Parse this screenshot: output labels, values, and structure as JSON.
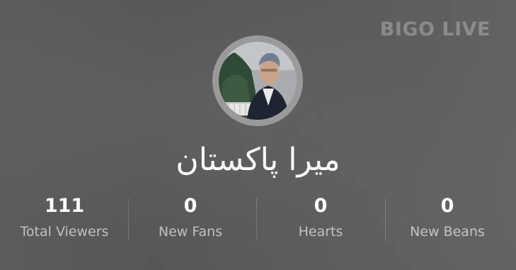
{
  "watermark": "BIGO LIVE",
  "profile": {
    "name": "میرا پاکستان"
  },
  "stats": [
    {
      "value": "111",
      "label": "Total Viewers"
    },
    {
      "value": "0",
      "label": "New Fans"
    },
    {
      "value": "0",
      "label": "Hearts"
    },
    {
      "value": "0",
      "label": "New Beans"
    }
  ],
  "colors": {
    "background": "#5a5a5a",
    "avatar_ring": "#9a9a9a",
    "value_text": "#ffffff",
    "label_text": "#b8b8b8"
  }
}
